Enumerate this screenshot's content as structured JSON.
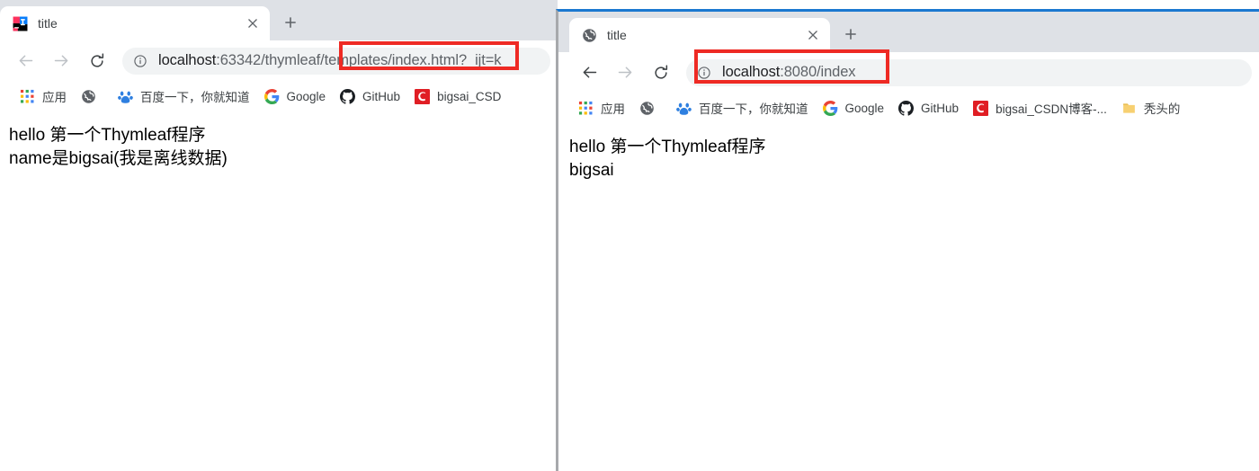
{
  "windows": {
    "left": {
      "tab": {
        "title": "title",
        "favicon": "intellij-idea-icon",
        "close_icon": "close-icon",
        "new_tab_icon": "plus-icon"
      },
      "toolbar": {
        "back_icon": "back-arrow-icon",
        "forward_icon": "forward-arrow-icon",
        "reload_icon": "reload-icon",
        "info_icon": "info-circle-icon",
        "url_host": "localhost",
        "url_rest": ":63342/thymleaf/templates/index.html?_ijt=k"
      },
      "bookmarks": [
        {
          "label": "应用",
          "icon": "apps-grid-icon"
        },
        {
          "label": "",
          "icon": "globe-icon"
        },
        {
          "label": "百度一下，你就知道",
          "icon": "baidu-icon"
        },
        {
          "label": "Google",
          "icon": "google-icon"
        },
        {
          "label": "GitHub",
          "icon": "github-icon"
        },
        {
          "label": "bigsai_CSD",
          "icon": "csdn-icon"
        }
      ],
      "page": {
        "line1": "hello 第一个Thymleaf程序",
        "line2": "name是bigsai(我是离线数据)"
      }
    },
    "right": {
      "tab": {
        "title": "title",
        "favicon": "globe-icon",
        "close_icon": "close-icon",
        "new_tab_icon": "plus-icon"
      },
      "toolbar": {
        "back_icon": "back-arrow-icon",
        "forward_icon": "forward-arrow-icon",
        "reload_icon": "reload-icon",
        "info_icon": "info-circle-icon",
        "url_host": "localhost",
        "url_rest": ":8080/index"
      },
      "bookmarks": [
        {
          "label": "应用",
          "icon": "apps-grid-icon"
        },
        {
          "label": "",
          "icon": "globe-icon"
        },
        {
          "label": "百度一下，你就知道",
          "icon": "baidu-icon"
        },
        {
          "label": "Google",
          "icon": "google-icon"
        },
        {
          "label": "GitHub",
          "icon": "github-icon"
        },
        {
          "label": "bigsai_CSDN博客-...",
          "icon": "csdn-icon"
        },
        {
          "label": "秃头的",
          "icon": "folder-icon"
        }
      ],
      "page": {
        "line1": "hello 第一个Thymleaf程序",
        "line2": "bigsai"
      }
    }
  },
  "annotations": {
    "highlight_color": "#ee2a24",
    "left_box_label": "url-path-highlight",
    "right_box_label": "url-highlight"
  }
}
